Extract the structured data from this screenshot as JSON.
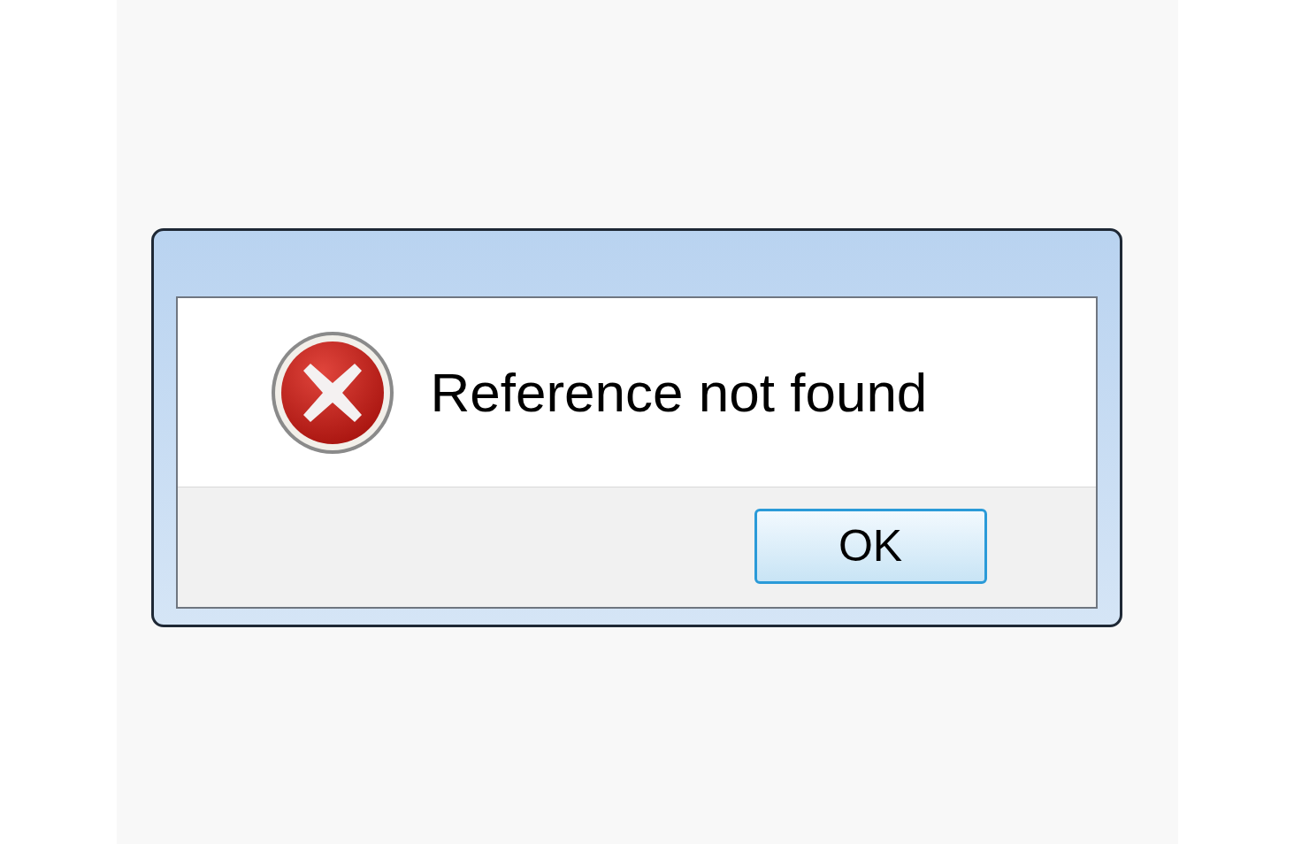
{
  "dialog": {
    "icon": {
      "kind": "error"
    },
    "message": "Reference not found",
    "buttons": [
      {
        "label": "OK",
        "focused": true
      }
    ]
  }
}
